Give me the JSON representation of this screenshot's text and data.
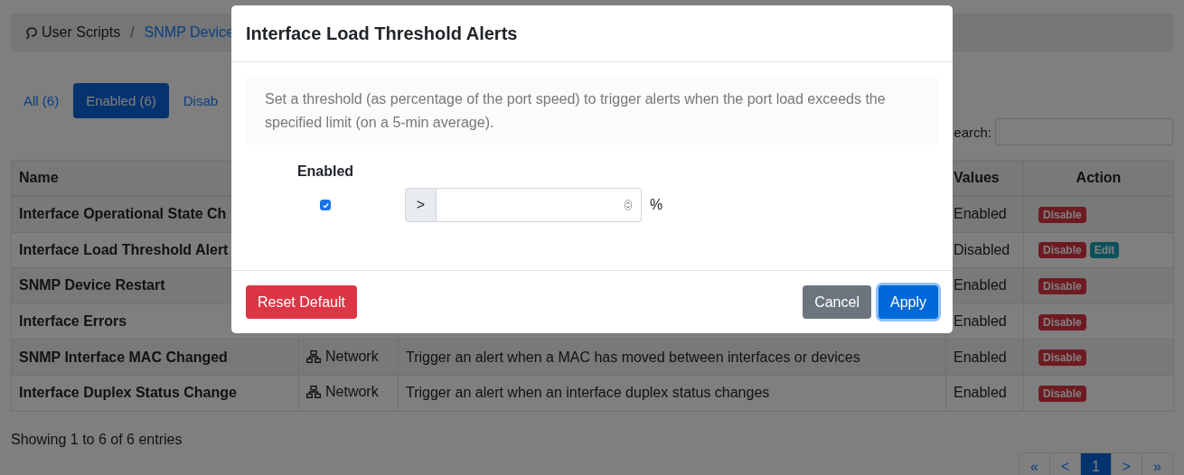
{
  "breadcrumb": [
    {
      "label": "User Scripts",
      "kind": "root"
    },
    {
      "label": "SNMP Device",
      "kind": "link"
    }
  ],
  "breadcrumb_separator": "/",
  "tabs": [
    {
      "label": "All (6)",
      "selected": false
    },
    {
      "label": "Enabled (6)",
      "selected": true
    },
    {
      "label": "Disab",
      "selected": false
    }
  ],
  "search": {
    "label": "earch:"
  },
  "table": {
    "columns": [
      "Name",
      "",
      "",
      "Values",
      "Action"
    ],
    "rows": [
      {
        "name": "Interface Operational State Ch",
        "values": "Enabled",
        "actions": [
          {
            "label": "Disable",
            "kind": "danger"
          }
        ]
      },
      {
        "name": "Interface Load Threshold Alert",
        "values": "Disabled",
        "actions": [
          {
            "label": "Disable",
            "kind": "danger"
          },
          {
            "label": "Edit",
            "kind": "info"
          }
        ]
      },
      {
        "name": "SNMP Device Restart",
        "values": "Enabled",
        "actions": [
          {
            "label": "Disable",
            "kind": "danger"
          }
        ]
      },
      {
        "name": "Interface Errors",
        "values": "Enabled",
        "actions": [
          {
            "label": "Disable",
            "kind": "danger"
          }
        ]
      },
      {
        "name": "SNMP Interface MAC Changed",
        "category": "Network",
        "description": "Trigger an alert when a MAC has moved between interfaces or devices",
        "values": "Enabled",
        "actions": [
          {
            "label": "Disable",
            "kind": "danger"
          }
        ]
      },
      {
        "name": "Interface Duplex Status Change",
        "category": "Network",
        "description": "Trigger an alert when an interface duplex status changes",
        "values": "Enabled",
        "actions": [
          {
            "label": "Disable",
            "kind": "danger"
          }
        ]
      }
    ]
  },
  "footer": "Showing 1 to 6 of 6 entries",
  "pagination": [
    {
      "label": "«",
      "selected": false
    },
    {
      "label": "<",
      "selected": false
    },
    {
      "label": "1",
      "selected": true
    },
    {
      "label": ">",
      "selected": false
    },
    {
      "label": "»",
      "selected": false
    }
  ],
  "modal": {
    "title": "Interface Load Threshold Alerts",
    "info": "Set a threshold (as percentage of the port speed) to trigger alerts when the port load exceeds the specified limit (on a 5-min average).",
    "enabled_label": "Enabled",
    "enabled": true,
    "operator": ">",
    "unit": "%",
    "buttons": [
      {
        "label": "Reset Default",
        "kind": "danger"
      },
      {
        "label": "Cancel",
        "kind": "secondary"
      },
      {
        "label": "Apply",
        "kind": "primary"
      }
    ]
  }
}
